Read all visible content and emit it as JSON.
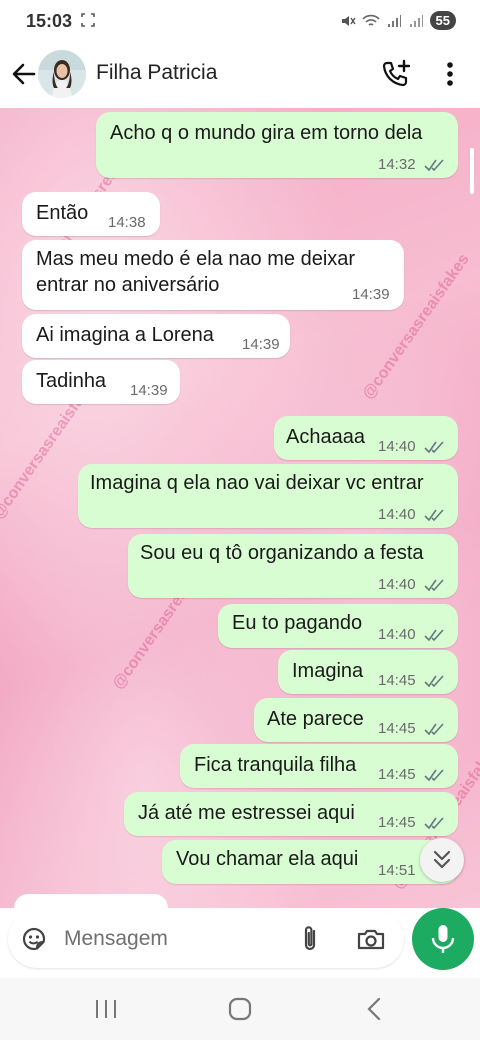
{
  "status_bar": {
    "time": "15:03",
    "battery": "55"
  },
  "header": {
    "contact_name": "Filha Patricia"
  },
  "watermark": "@conversasreaisfakes",
  "messages": [
    {
      "dir": "out",
      "text": "Acho q o mundo gira em torno dela",
      "time": "14:32"
    },
    {
      "dir": "in",
      "text": "Então",
      "time": "14:38"
    },
    {
      "dir": "in",
      "text_line1": "Mas meu medo é ela nao me deixar",
      "text_line2": "entrar no aniversário",
      "time": "14:39"
    },
    {
      "dir": "in",
      "text": "Ai imagina a Lorena",
      "time": "14:39"
    },
    {
      "dir": "in",
      "text": "Tadinha",
      "time": "14:39"
    },
    {
      "dir": "out",
      "text": "Achaaaa",
      "time": "14:40"
    },
    {
      "dir": "out",
      "text": "Imagina q ela nao vai deixar vc entrar",
      "time": "14:40"
    },
    {
      "dir": "out",
      "text": "Sou eu q tô organizando a festa",
      "time": "14:40"
    },
    {
      "dir": "out",
      "text": "Eu to pagando",
      "time": "14:40"
    },
    {
      "dir": "out",
      "text": "Imagina",
      "time": "14:45"
    },
    {
      "dir": "out",
      "text": "Ate parece",
      "time": "14:45"
    },
    {
      "dir": "out",
      "text": "Fica tranquila filha",
      "time": "14:45"
    },
    {
      "dir": "out",
      "text": "Já até me estressei aqui",
      "time": "14:45"
    },
    {
      "dir": "out",
      "text": "Vou chamar ela aqui",
      "time": "14:51"
    }
  ],
  "input": {
    "placeholder": "Mensagem"
  },
  "icons": {
    "back": "arrow-left-icon",
    "call": "add-call-icon",
    "menu": "more-vert-icon",
    "emoji": "sticker-icon",
    "attach": "paperclip-icon",
    "camera": "camera-icon",
    "mic": "microphone-icon",
    "scroll": "double-chevron-down-icon"
  },
  "colors": {
    "outgoing_bubble": "#d9fdd3",
    "incoming_bubble": "#ffffff",
    "mic_button": "#1daa61",
    "read_ticks": "#667781"
  }
}
